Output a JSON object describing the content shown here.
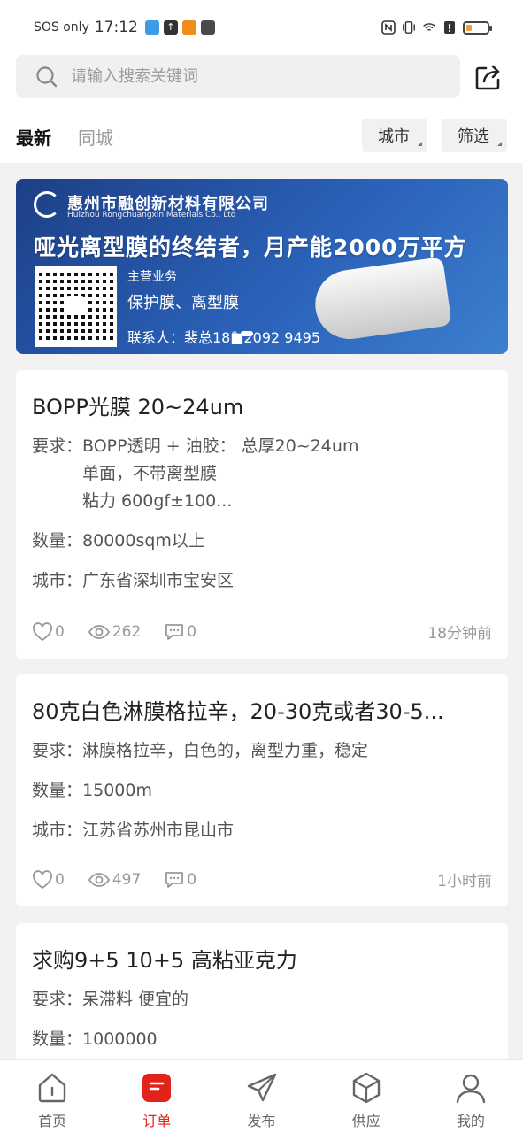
{
  "status_bar": {
    "carrier": "SOS only",
    "time": "17:12",
    "icons_left": [
      "app-icon-1",
      "upload-icon",
      "app-icon-2",
      "app-icon-3"
    ],
    "icons_right": [
      "nfc-icon",
      "vibrate-icon",
      "wifi-icon",
      "alert-icon",
      "battery-icon"
    ],
    "battery_level": 0.2,
    "battery_color": "#e9a23b"
  },
  "search": {
    "placeholder": "请输入搜索关键词"
  },
  "tabs": {
    "latest": "最新",
    "same_city": "同城"
  },
  "filters": {
    "city": "城市",
    "filter": "筛选"
  },
  "banner": {
    "company": "惠州市融创新材料有限公司",
    "company_en": "Huizhou Rongchuangxin Materials Co., Ltd",
    "slogan": "哑光离型膜的终结者，月产能2000万平方",
    "business_label": "主营业务",
    "business": "保护膜、离型膜",
    "contact": "联系人：裴总18■2092 9495",
    "carousel_index": 1
  },
  "cards": [
    {
      "title": "BOPP光膜 20~24um",
      "requirement_label": "要求：",
      "requirement_lines": [
        "BOPP透明 + 油胶： 总厚20~24um",
        "单面，不带离型膜",
        "粘力 600gf±100..."
      ],
      "quantity_label": "数量：",
      "quantity": "80000sqm以上",
      "city_label": "城市：",
      "city": "广东省深圳市宝安区",
      "likes": "0",
      "views": "262",
      "comments": "0",
      "time": "18分钟前"
    },
    {
      "title": "80克白色淋膜格拉辛，20-30克或者30-5...",
      "requirement_label": "要求：",
      "requirement_lines": [
        "淋膜格拉辛，白色的，离型力重，稳定"
      ],
      "quantity_label": "数量：",
      "quantity": "15000m",
      "city_label": "城市：",
      "city": "江苏省苏州市昆山市",
      "likes": "0",
      "views": "497",
      "comments": "0",
      "time": "1小时前"
    },
    {
      "title": "求购9+5 10+5 高粘亚克力",
      "requirement_label": "要求：",
      "requirement_lines": [
        "呆滞料 便宜的"
      ],
      "quantity_label": "数量：",
      "quantity": "1000000"
    }
  ],
  "nav": {
    "home": "首页",
    "orders": "订单",
    "publish": "发布",
    "supply": "供应",
    "mine": "我的",
    "active_color": "#e2231a"
  }
}
